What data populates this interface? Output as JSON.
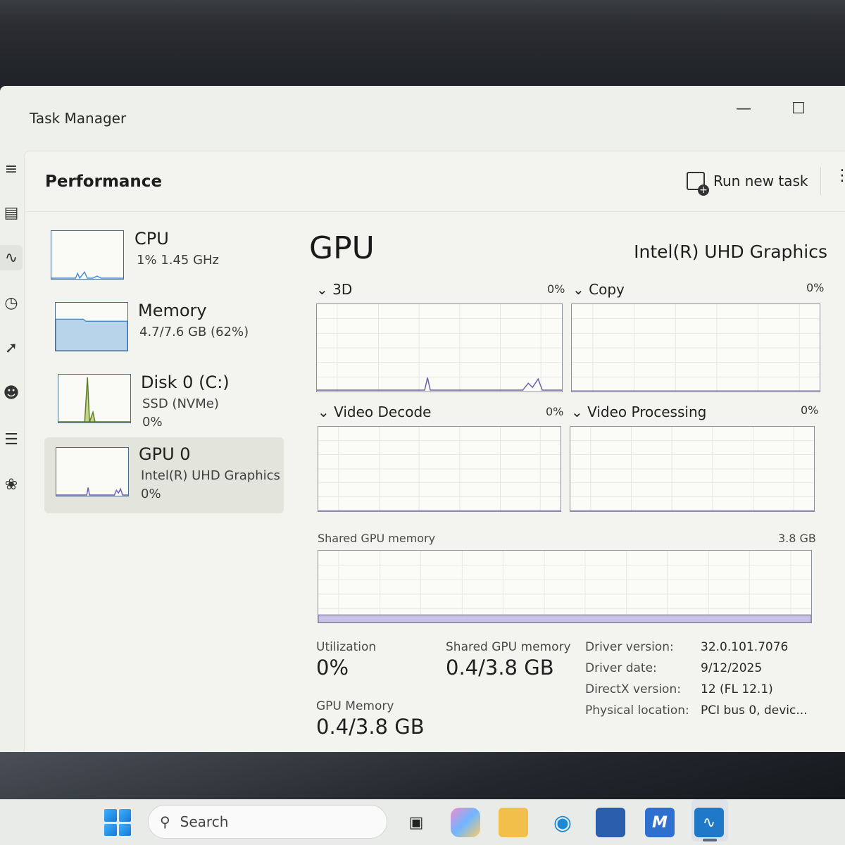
{
  "window": {
    "title": "Task Manager"
  },
  "header": {
    "page_title": "Performance",
    "run_task_label": "Run new task"
  },
  "devices": [
    {
      "name": "CPU",
      "line1": "1% 1.45 GHz",
      "line2": ""
    },
    {
      "name": "Memory",
      "line1": "4.7/7.6 GB (62%)",
      "line2": ""
    },
    {
      "name": "Disk 0 (C:)",
      "line1": "SSD (NVMe)",
      "line2": "0%"
    },
    {
      "name": "GPU 0",
      "line1": "Intel(R) UHD Graphics",
      "line2": "0%"
    }
  ],
  "gpu": {
    "title": "GPU",
    "model": "Intel(R) UHD Graphics",
    "engines": [
      {
        "label": "3D",
        "pct": "0%"
      },
      {
        "label": "Copy",
        "pct": "0%"
      },
      {
        "label": "Video Decode",
        "pct": "0%"
      },
      {
        "label": "Video Processing",
        "pct": "0%"
      }
    ],
    "shared_memory_graph": {
      "label": "Shared GPU memory",
      "max": "3.8 GB"
    },
    "stats": {
      "utilization_label": "Utilization",
      "utilization_value": "0%",
      "shared_label": "Shared GPU memory",
      "shared_value": "0.4/3.8 GB",
      "gpu_memory_label": "GPU Memory",
      "gpu_memory_value": "0.4/3.8 GB"
    },
    "details": [
      {
        "key": "Driver version:",
        "value": "32.0.101.7076"
      },
      {
        "key": "Driver date:",
        "value": "9/12/2025"
      },
      {
        "key": "DirectX version:",
        "value": "12 (FL 12.1)"
      },
      {
        "key": "Physical location:",
        "value": "PCI bus 0, devic..."
      }
    ]
  },
  "taskbar": {
    "search_placeholder": "Search"
  },
  "colors": {
    "accent_cpu": "#4a8fd0",
    "memory_fill": "#b8d4ea",
    "disk_line": "#5a7d2a",
    "gpu_line": "#6c5fb0"
  }
}
